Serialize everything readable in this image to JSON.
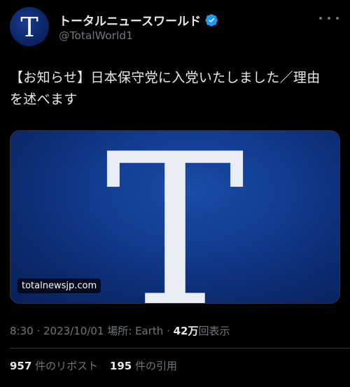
{
  "account": {
    "avatar_letter": "T",
    "display_name": "トータルニュースワールド",
    "handle": "@TotalWorld1",
    "verified_color": "#1d9bf0"
  },
  "tweet": {
    "text_line1": "【お知らせ】日本保守党に入党いたしました／理由",
    "text_line2": "を述べます"
  },
  "media": {
    "letter": "T",
    "domain": "totalnewsjp.com"
  },
  "meta": {
    "time": "8:30",
    "sep1": " · ",
    "date": "2023/10/01",
    "location_label": " 場所: ",
    "location": "Earth",
    "sep2": " · ",
    "views_count": "42万",
    "views_label": "回表示"
  },
  "stats": {
    "reposts_count": "957",
    "reposts_label": "件のリポスト",
    "quotes_count": "195",
    "quotes_label": "件の引用"
  },
  "colors": {
    "background": "#000000",
    "text": "#e7e9ea",
    "muted": "#71767b",
    "media_blue": "#123d91"
  }
}
